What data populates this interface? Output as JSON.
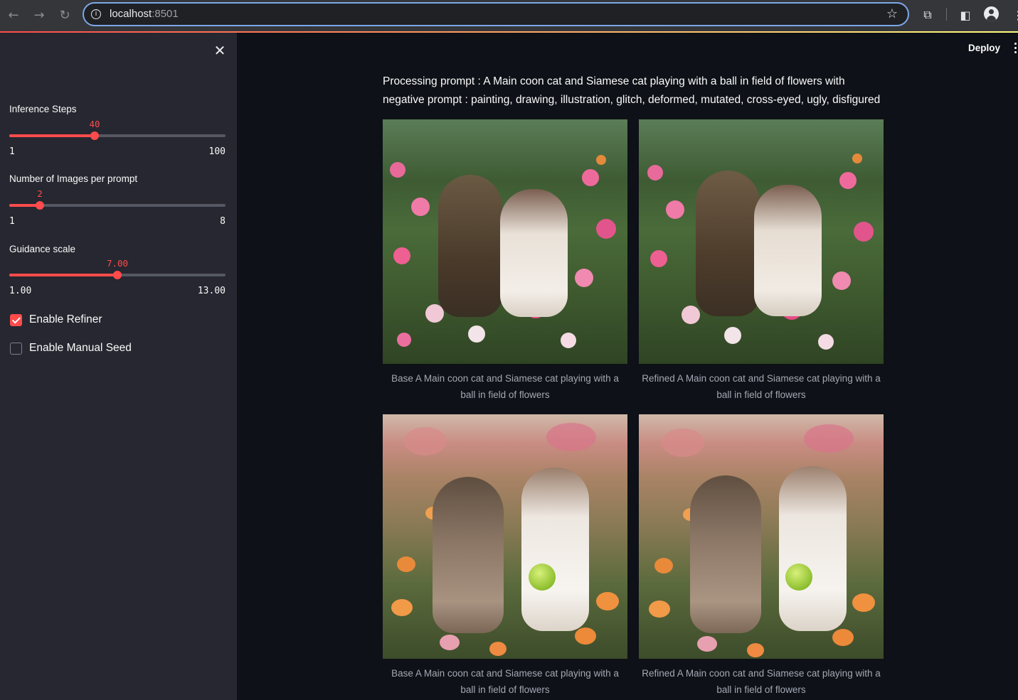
{
  "browser": {
    "url_host": "localhost",
    "url_port": ":8501"
  },
  "header": {
    "deploy_label": "Deploy"
  },
  "sidebar": {
    "sliders": [
      {
        "label": "Inference Steps",
        "value": "40",
        "min": "1",
        "max": "100",
        "fraction": 0.394
      },
      {
        "label": "Number of Images per prompt",
        "value": "2",
        "min": "1",
        "max": "8",
        "fraction": 0.143
      },
      {
        "label": "Guidance scale",
        "value": "7.00",
        "min": "1.00",
        "max": "13.00",
        "fraction": 0.5
      }
    ],
    "checkboxes": [
      {
        "label": "Enable Refiner",
        "checked": true
      },
      {
        "label": "Enable Manual Seed",
        "checked": false
      }
    ]
  },
  "main": {
    "prompt_text": "Processing prompt : A Main coon cat and Siamese cat playing with a ball in field of flowers with negative prompt : painting, drawing, illustration, glitch, deformed, mutated, cross-eyed, ugly, disfigured",
    "images": [
      {
        "caption": "Base A Main coon cat and Siamese cat playing with a ball in field of flowers"
      },
      {
        "caption": "Refined A Main coon cat and Siamese cat playing with a ball in field of flowers"
      },
      {
        "caption": "Base A Main coon cat and Siamese cat playing with a ball in field of flowers"
      },
      {
        "caption": "Refined A Main coon cat and Siamese cat playing with a ball in field of flowers"
      }
    ]
  },
  "colors": {
    "accent": "#ff4b4b",
    "sidebar_bg": "#262730",
    "main_bg": "#0e1117"
  }
}
